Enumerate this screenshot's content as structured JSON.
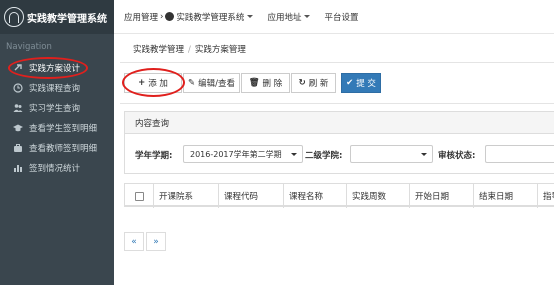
{
  "app": {
    "title": "实践教学管理系统"
  },
  "sidebar": {
    "heading": "Navigation",
    "items": [
      {
        "label": "实践方案设计",
        "icon": "link-icon"
      },
      {
        "label": "实践课程查询",
        "icon": "clock-icon"
      },
      {
        "label": "实习学生查询",
        "icon": "users-icon"
      },
      {
        "label": "查看学生签到明细",
        "icon": "graduation-cap-icon"
      },
      {
        "label": "查看教师签到明细",
        "icon": "briefcase-icon"
      },
      {
        "label": "签到情况统计",
        "icon": "bar-chart-icon"
      }
    ]
  },
  "topbar": {
    "app_manage": "应用管理",
    "current_system": "实践教学管理系统",
    "app_address": "应用地址",
    "platform_settings": "平台设置"
  },
  "breadcrumb": {
    "level1": "实践教学管理",
    "level2": "实践方案管理"
  },
  "toolbar": {
    "add_label": "添 加",
    "edit_label": "编辑/查看",
    "delete_label": "删 除",
    "refresh_label": "刷 新",
    "submit_label": "提 交"
  },
  "query": {
    "title": "内容查询",
    "term_label": "学年学期:",
    "term_value": "2016-2017学年第二学期",
    "college_label": "二级学院:",
    "college_value": "",
    "status_label": "审核状态:",
    "status_value": ""
  },
  "table": {
    "columns": [
      "开课院系",
      "课程代码",
      "课程名称",
      "实践周数",
      "开始日期",
      "结束日期",
      "指导"
    ]
  },
  "pager": {
    "prev": "«",
    "next": "»"
  },
  "colors": {
    "sidebar": "#3a464e",
    "brand": "#2f3a41",
    "primary": "#337ab7",
    "annotation": "#e0201d"
  }
}
